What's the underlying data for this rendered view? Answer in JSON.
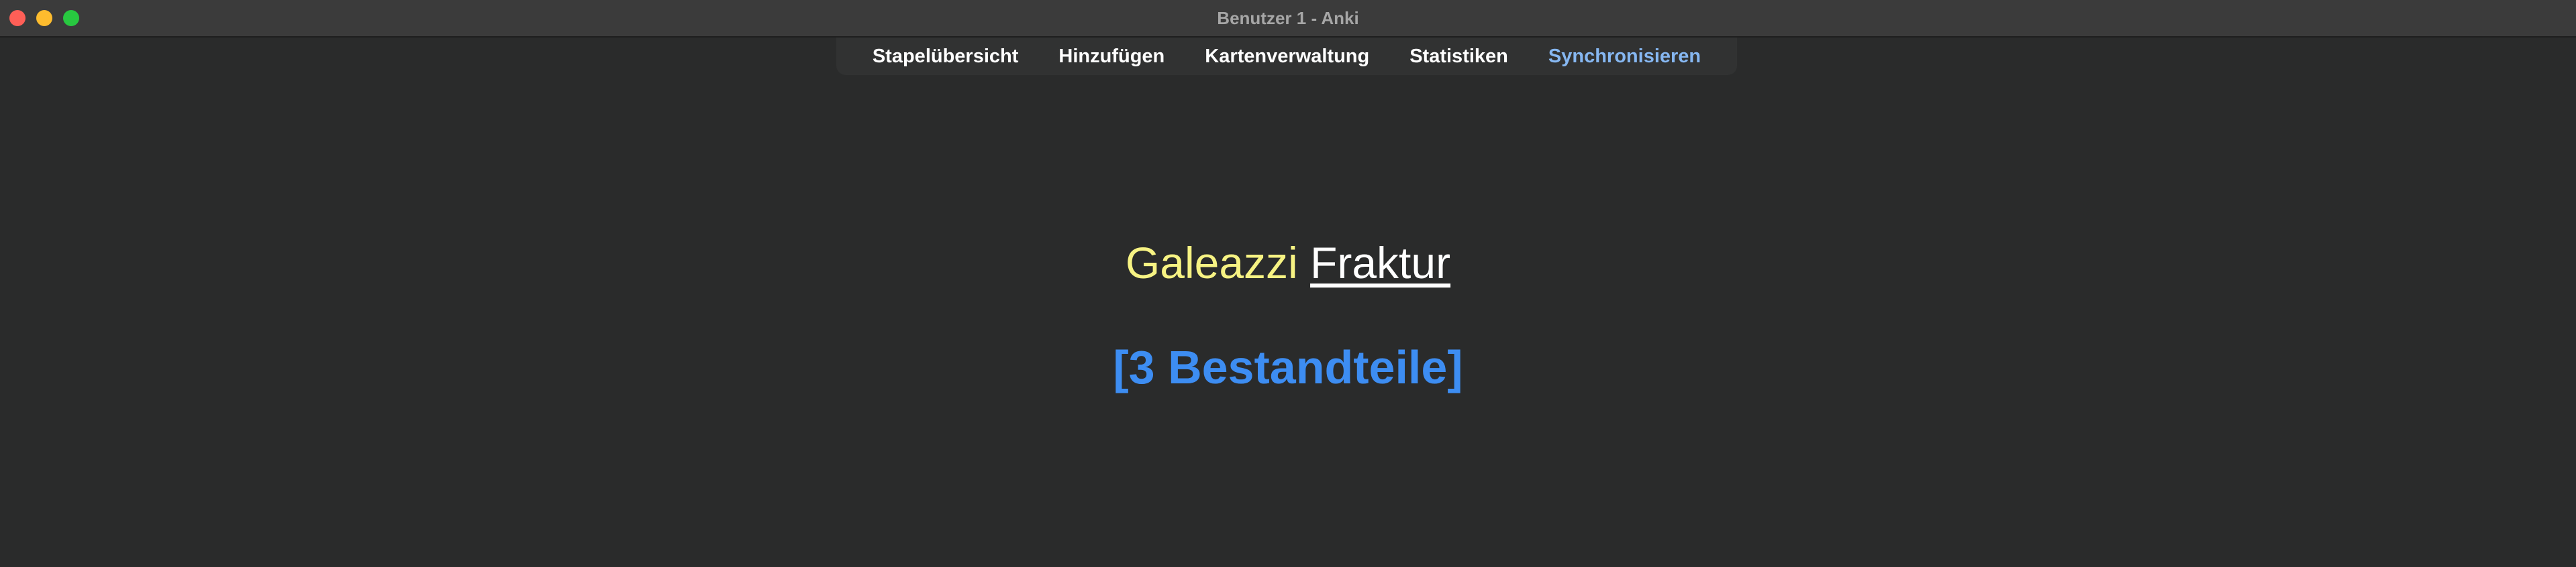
{
  "window": {
    "title": "Benutzer 1 - Anki"
  },
  "toolbar": {
    "items": [
      {
        "label": "Stapelübersicht"
      },
      {
        "label": "Hinzufügen"
      },
      {
        "label": "Kartenverwaltung"
      },
      {
        "label": "Statistiken"
      },
      {
        "label": "Synchronisieren"
      }
    ]
  },
  "card": {
    "front_highlight": "Galeazzi",
    "front_term": "Fraktur",
    "back_text": "[3 Bestandteile]"
  },
  "colors": {
    "background": "#2a2b2b",
    "highlight_yellow": "#f7f383",
    "answer_blue": "#3d8df2",
    "sync_accent": "#86b7f1"
  }
}
